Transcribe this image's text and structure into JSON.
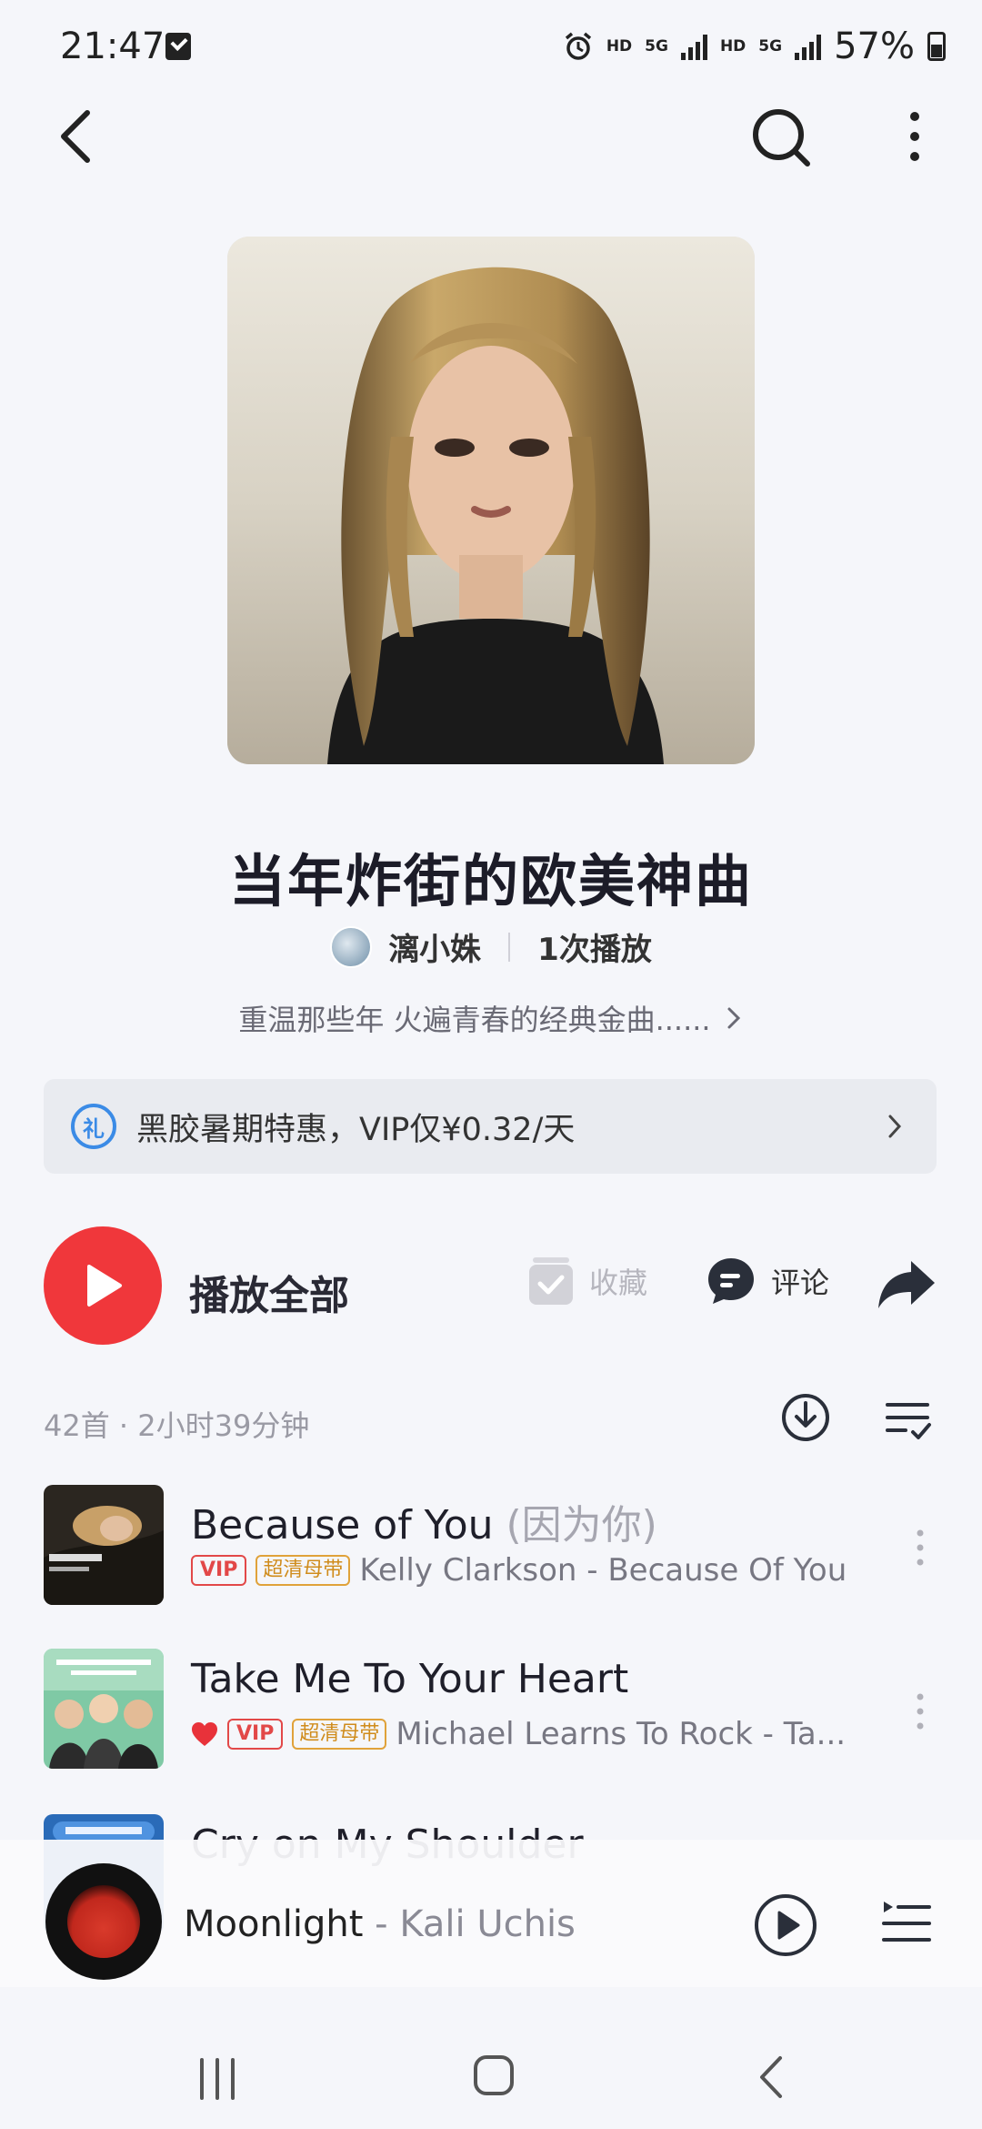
{
  "status_bar": {
    "time": "21:47",
    "hd1": "HD",
    "net1": "5G",
    "hd2": "HD",
    "net2": "5G",
    "battery": "57%"
  },
  "header": {
    "back_icon": "back-chevron-icon",
    "search_icon": "search-icon",
    "more_icon": "more-vertical-icon"
  },
  "playlist": {
    "title": "当年炸街的欧美神曲",
    "creator": "漓小姝",
    "play_count": "1次播放",
    "description": "重温那些年 火遍青春的经典金曲......"
  },
  "vip_banner": {
    "icon_text": "礼",
    "text": "黑胶暑期特惠，VIP仅¥0.32/天"
  },
  "actions": {
    "play_all": "播放全部",
    "favorite": "收藏",
    "comment": "评论"
  },
  "list": {
    "summary": "42首 · 2小时39分钟",
    "songs": [
      {
        "title": "Because of You",
        "alias": "(因为你)",
        "liked": false,
        "vip": "VIP",
        "quality": "超清母带",
        "artist_album": "Kelly Clarkson - Because Of You"
      },
      {
        "title": "Take Me To Your Heart",
        "alias": "",
        "liked": true,
        "vip": "VIP",
        "quality": "超清母带",
        "artist_album": "Michael Learns To Rock - Ta..."
      },
      {
        "title": "Cry on My Shoulder",
        "alias": "",
        "liked": false,
        "vip": "",
        "quality": "",
        "artist_album": ""
      }
    ]
  },
  "mini_player": {
    "title": "Moonlight",
    "separator": " - ",
    "artist": "Kali Uchis"
  },
  "colors": {
    "accent_red": "#f0373b",
    "vip_blue": "#3b8be6",
    "background": "#f5f6fa"
  }
}
